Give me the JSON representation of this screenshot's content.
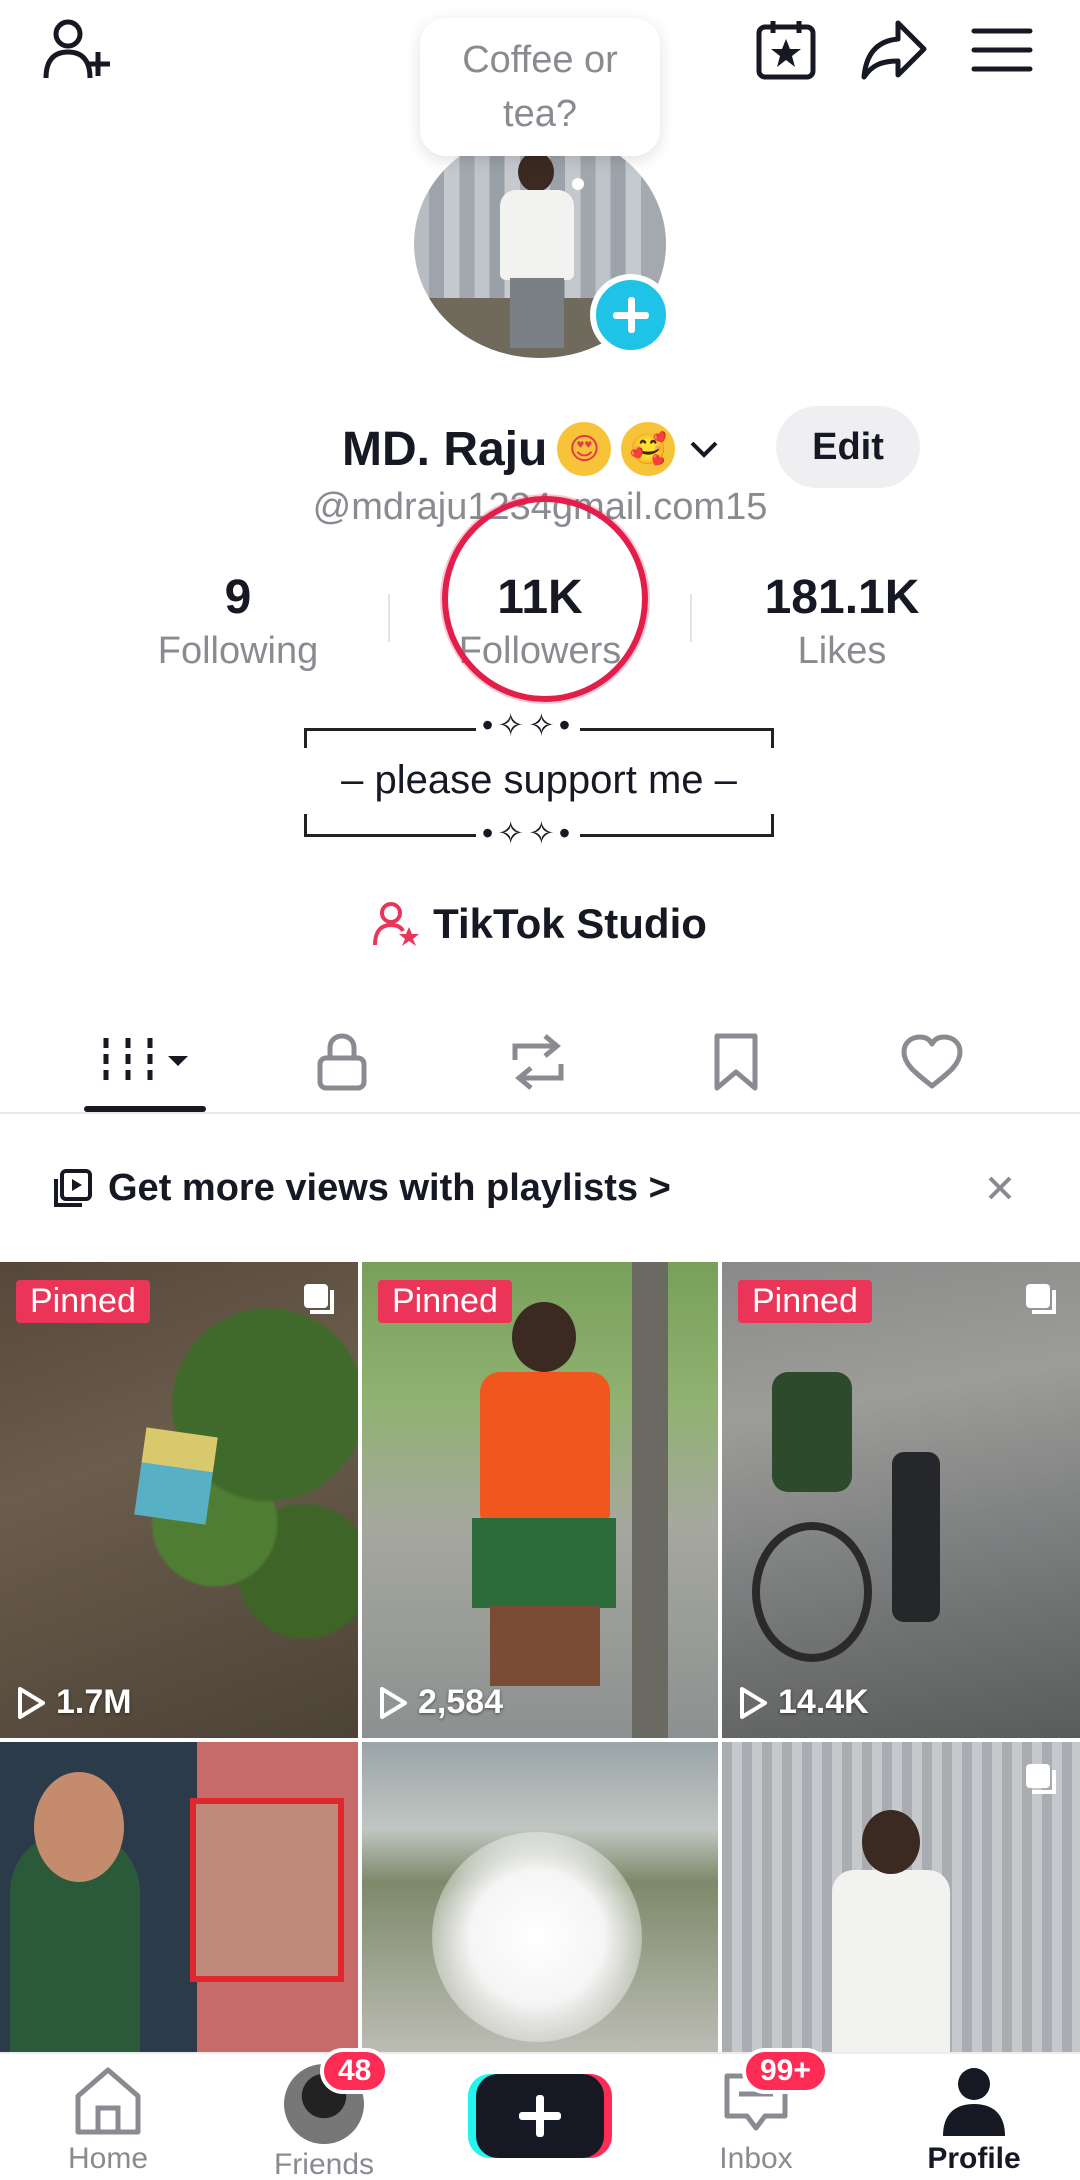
{
  "bubble": {
    "text": "Coffee or tea?"
  },
  "profile": {
    "name": "MD. Raju",
    "emojis": [
      "😍",
      "🥰"
    ],
    "handle": "@mdraju1234gmail.com15",
    "edit_label": "Edit"
  },
  "stats": [
    {
      "value": "9",
      "label": "Following"
    },
    {
      "value": "11K",
      "label": "Followers"
    },
    {
      "value": "181.1K",
      "label": "Likes"
    }
  ],
  "bio": {
    "stars": "•✧✧•",
    "text": "– please support me –"
  },
  "studio": {
    "label": "TikTok Studio"
  },
  "tabs": [
    "videos-grid-icon",
    "lock-icon",
    "repost-icon",
    "bookmark-icon",
    "heart-icon"
  ],
  "banner": {
    "text": "Get more views with playlists >"
  },
  "videos": [
    {
      "pinned": "Pinned",
      "views": "1.7M"
    },
    {
      "pinned": "Pinned",
      "views": "2,584"
    },
    {
      "pinned": "Pinned",
      "views": "14.4K"
    }
  ],
  "nav": {
    "home": "Home",
    "friends": "Friends",
    "friends_badge": "48",
    "inbox": "Inbox",
    "inbox_badge": "99+",
    "profile": "Profile"
  },
  "colors": {
    "accent": "#fe2c55",
    "cyan": "#20c3e8",
    "text": "#161823",
    "muted": "#8a8b91"
  }
}
